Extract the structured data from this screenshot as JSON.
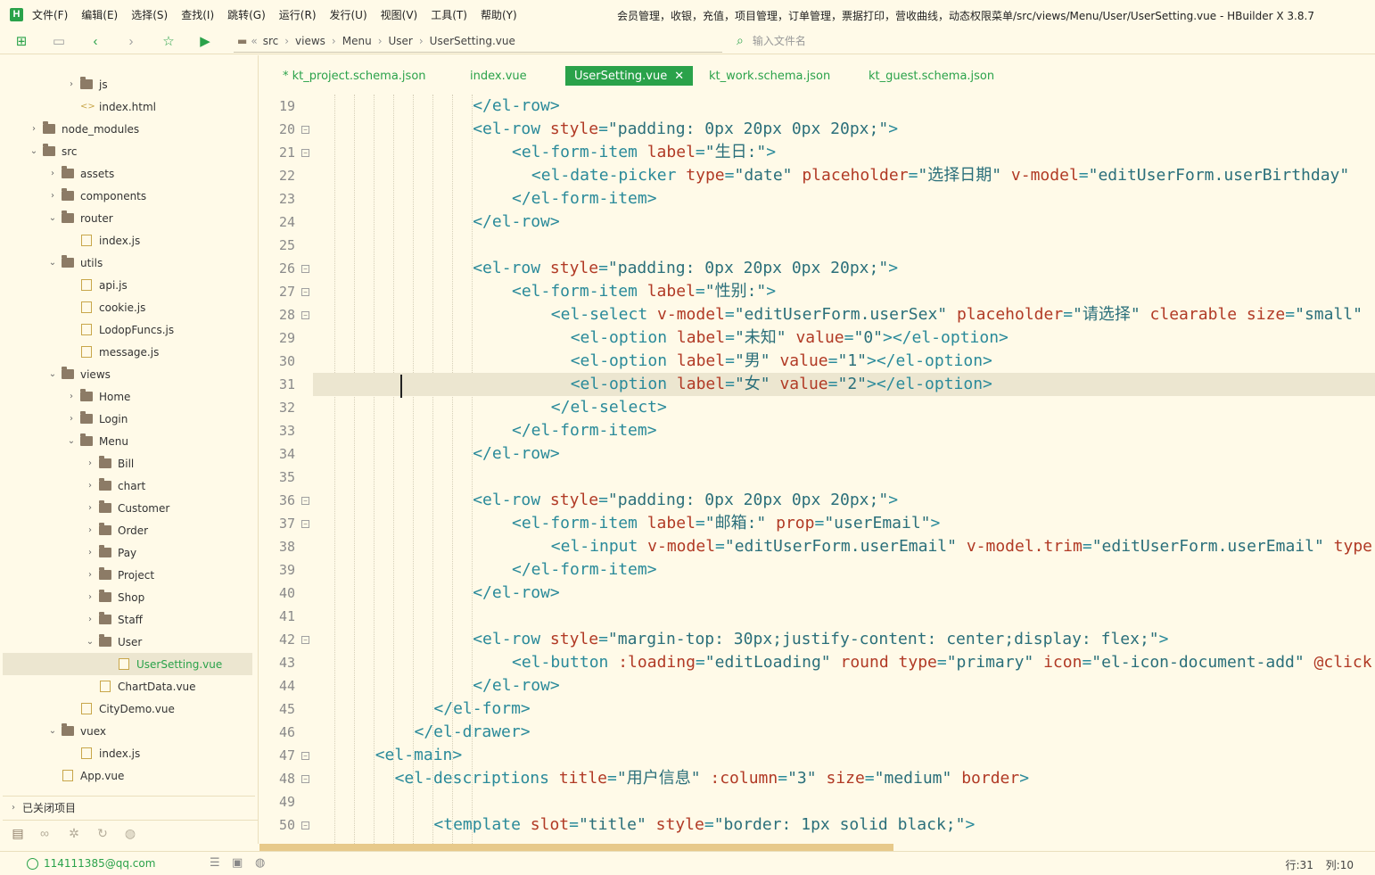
{
  "menubar": {
    "items": [
      "文件(F)",
      "编辑(E)",
      "选择(S)",
      "查找(I)",
      "跳转(G)",
      "运行(R)",
      "发行(U)",
      "视图(V)",
      "工具(T)",
      "帮助(Y)"
    ],
    "window_title": "会员管理，收银，充值，项目管理，订单管理，票据打印，营收曲线，动态权限菜单/src/views/Menu/User/UserSetting.vue - HBuilder X 3.8.7"
  },
  "toolbar": {
    "breadcrumb": [
      "src",
      "views",
      "Menu",
      "User",
      "UserSetting.vue"
    ],
    "file_search_placeholder": "输入文件名"
  },
  "sidebar": {
    "tree": [
      {
        "label": "js",
        "type": "folder",
        "depth": 3,
        "expanded": false
      },
      {
        "label": "index.html",
        "type": "html",
        "depth": 3
      },
      {
        "label": "node_modules",
        "type": "folder",
        "depth": 1,
        "expanded": false
      },
      {
        "label": "src",
        "type": "folder",
        "depth": 1,
        "expanded": true
      },
      {
        "label": "assets",
        "type": "folder",
        "depth": 2,
        "expanded": false
      },
      {
        "label": "components",
        "type": "folder",
        "depth": 2,
        "expanded": false
      },
      {
        "label": "router",
        "type": "folder",
        "depth": 2,
        "expanded": true
      },
      {
        "label": "index.js",
        "type": "file",
        "depth": 3
      },
      {
        "label": "utils",
        "type": "folder",
        "depth": 2,
        "expanded": true
      },
      {
        "label": "api.js",
        "type": "file",
        "depth": 3
      },
      {
        "label": "cookie.js",
        "type": "file",
        "depth": 3
      },
      {
        "label": "LodopFuncs.js",
        "type": "file",
        "depth": 3
      },
      {
        "label": "message.js",
        "type": "file",
        "depth": 3
      },
      {
        "label": "views",
        "type": "folder",
        "depth": 2,
        "expanded": true
      },
      {
        "label": "Home",
        "type": "folder",
        "depth": 3,
        "expanded": false
      },
      {
        "label": "Login",
        "type": "folder",
        "depth": 3,
        "expanded": false
      },
      {
        "label": "Menu",
        "type": "folder",
        "depth": 3,
        "expanded": true
      },
      {
        "label": "Bill",
        "type": "folder",
        "depth": 4,
        "expanded": false
      },
      {
        "label": "chart",
        "type": "folder",
        "depth": 4,
        "expanded": false
      },
      {
        "label": "Customer",
        "type": "folder",
        "depth": 4,
        "expanded": false
      },
      {
        "label": "Order",
        "type": "folder",
        "depth": 4,
        "expanded": false
      },
      {
        "label": "Pay",
        "type": "folder",
        "depth": 4,
        "expanded": false
      },
      {
        "label": "Project",
        "type": "folder",
        "depth": 4,
        "expanded": false
      },
      {
        "label": "Shop",
        "type": "folder",
        "depth": 4,
        "expanded": false
      },
      {
        "label": "Staff",
        "type": "folder",
        "depth": 4,
        "expanded": false
      },
      {
        "label": "User",
        "type": "folder",
        "depth": 4,
        "expanded": true
      },
      {
        "label": "UserSetting.vue",
        "type": "file",
        "depth": 5,
        "selected": true
      },
      {
        "label": "ChartData.vue",
        "type": "file",
        "depth": 4
      },
      {
        "label": "CityDemo.vue",
        "type": "file",
        "depth": 3
      },
      {
        "label": "vuex",
        "type": "folder",
        "depth": 2,
        "expanded": true
      },
      {
        "label": "index.js",
        "type": "file",
        "depth": 3
      },
      {
        "label": "App.vue",
        "type": "file",
        "depth": 2
      }
    ],
    "closed_projects": "已关闭项目"
  },
  "tabs": [
    {
      "label": "* kt_project.schema.json",
      "active": false
    },
    {
      "label": "index.vue",
      "active": false
    },
    {
      "label": "UserSetting.vue",
      "active": true
    },
    {
      "label": "kt_work.schema.json",
      "active": false
    },
    {
      "label": "kt_guest.schema.json",
      "active": false
    }
  ],
  "editor": {
    "current_line": 31,
    "lines": [
      {
        "n": "19",
        "indent": 8,
        "fold": false,
        "tokens": [
          [
            "tg",
            "</el-row>"
          ]
        ]
      },
      {
        "n": "20",
        "indent": 8,
        "fold": true,
        "tokens": [
          [
            "tg",
            "<el-row "
          ],
          [
            "at",
            "style"
          ],
          [
            "pc",
            "="
          ],
          [
            "st",
            "\"padding: 0px 20px 0px 20px;\""
          ],
          [
            "tg",
            ">"
          ]
        ]
      },
      {
        "n": "21",
        "indent": 10,
        "fold": true,
        "tokens": [
          [
            "tg",
            "<el-form-item "
          ],
          [
            "at",
            "label"
          ],
          [
            "pc",
            "="
          ],
          [
            "st",
            "\"生日:\""
          ],
          [
            "tg",
            ">"
          ]
        ]
      },
      {
        "n": "22",
        "indent": 11,
        "fold": false,
        "tokens": [
          [
            "tg",
            "<el-date-picker "
          ],
          [
            "at",
            "type"
          ],
          [
            "pc",
            "="
          ],
          [
            "st",
            "\"date\" "
          ],
          [
            "at",
            "placeholder"
          ],
          [
            "pc",
            "="
          ],
          [
            "st",
            "\"选择日期\" "
          ],
          [
            "at",
            "v-model"
          ],
          [
            "pc",
            "="
          ],
          [
            "st",
            "\"editUserForm.userBirthday\""
          ]
        ]
      },
      {
        "n": "23",
        "indent": 10,
        "fold": false,
        "tokens": [
          [
            "tg",
            "</el-form-item>"
          ]
        ]
      },
      {
        "n": "24",
        "indent": 8,
        "fold": false,
        "tokens": [
          [
            "tg",
            "</el-row>"
          ]
        ]
      },
      {
        "n": "25",
        "indent": 0,
        "fold": false,
        "tokens": []
      },
      {
        "n": "26",
        "indent": 8,
        "fold": true,
        "tokens": [
          [
            "tg",
            "<el-row "
          ],
          [
            "at",
            "style"
          ],
          [
            "pc",
            "="
          ],
          [
            "st",
            "\"padding: 0px 20px 0px 20px;\""
          ],
          [
            "tg",
            ">"
          ]
        ]
      },
      {
        "n": "27",
        "indent": 10,
        "fold": true,
        "tokens": [
          [
            "tg",
            "<el-form-item "
          ],
          [
            "at",
            "label"
          ],
          [
            "pc",
            "="
          ],
          [
            "st",
            "\"性别:\""
          ],
          [
            "tg",
            ">"
          ]
        ]
      },
      {
        "n": "28",
        "indent": 12,
        "fold": true,
        "tokens": [
          [
            "tg",
            "<el-select "
          ],
          [
            "at",
            "v-model"
          ],
          [
            "pc",
            "="
          ],
          [
            "st",
            "\"editUserForm.userSex\" "
          ],
          [
            "at",
            "placeholder"
          ],
          [
            "pc",
            "="
          ],
          [
            "st",
            "\"请选择\" "
          ],
          [
            "at",
            "clearable "
          ],
          [
            "at",
            "size"
          ],
          [
            "pc",
            "="
          ],
          [
            "st",
            "\"small\""
          ]
        ]
      },
      {
        "n": "29",
        "indent": 13,
        "fold": false,
        "tokens": [
          [
            "tg",
            "<el-option "
          ],
          [
            "at",
            "label"
          ],
          [
            "pc",
            "="
          ],
          [
            "st",
            "\"未知\" "
          ],
          [
            "at",
            "value"
          ],
          [
            "pc",
            "="
          ],
          [
            "st",
            "\"0\""
          ],
          [
            "tg",
            "></el-option>"
          ]
        ]
      },
      {
        "n": "30",
        "indent": 13,
        "fold": false,
        "tokens": [
          [
            "tg",
            "<el-option "
          ],
          [
            "at",
            "label"
          ],
          [
            "pc",
            "="
          ],
          [
            "st",
            "\"男\" "
          ],
          [
            "at",
            "value"
          ],
          [
            "pc",
            "="
          ],
          [
            "st",
            "\"1\""
          ],
          [
            "tg",
            "></el-option>"
          ]
        ]
      },
      {
        "n": "31",
        "indent": 13,
        "fold": false,
        "tokens": [
          [
            "tg",
            "<el-option "
          ],
          [
            "at",
            "label"
          ],
          [
            "pc",
            "="
          ],
          [
            "st",
            "\"女\" "
          ],
          [
            "at",
            "value"
          ],
          [
            "pc",
            "="
          ],
          [
            "st",
            "\"2\""
          ],
          [
            "tg",
            "></el-option>"
          ]
        ]
      },
      {
        "n": "32",
        "indent": 12,
        "fold": false,
        "tokens": [
          [
            "tg",
            "</el-select>"
          ]
        ]
      },
      {
        "n": "33",
        "indent": 10,
        "fold": false,
        "tokens": [
          [
            "tg",
            "</el-form-item>"
          ]
        ]
      },
      {
        "n": "34",
        "indent": 8,
        "fold": false,
        "tokens": [
          [
            "tg",
            "</el-row>"
          ]
        ]
      },
      {
        "n": "35",
        "indent": 0,
        "fold": false,
        "tokens": []
      },
      {
        "n": "36",
        "indent": 8,
        "fold": true,
        "tokens": [
          [
            "tg",
            "<el-row "
          ],
          [
            "at",
            "style"
          ],
          [
            "pc",
            "="
          ],
          [
            "st",
            "\"padding: 0px 20px 0px 20px;\""
          ],
          [
            "tg",
            ">"
          ]
        ]
      },
      {
        "n": "37",
        "indent": 10,
        "fold": true,
        "tokens": [
          [
            "tg",
            "<el-form-item "
          ],
          [
            "at",
            "label"
          ],
          [
            "pc",
            "="
          ],
          [
            "st",
            "\"邮箱:\" "
          ],
          [
            "at",
            "prop"
          ],
          [
            "pc",
            "="
          ],
          [
            "st",
            "\"userEmail\""
          ],
          [
            "tg",
            ">"
          ]
        ]
      },
      {
        "n": "38",
        "indent": 12,
        "fold": false,
        "tokens": [
          [
            "tg",
            "<el-input "
          ],
          [
            "at",
            "v-model"
          ],
          [
            "pc",
            "="
          ],
          [
            "st",
            "\"editUserForm.userEmail\" "
          ],
          [
            "at",
            "v-model.trim"
          ],
          [
            "pc",
            "="
          ],
          [
            "st",
            "\"editUserForm.userEmail\" "
          ],
          [
            "at",
            "type"
          ]
        ]
      },
      {
        "n": "39",
        "indent": 10,
        "fold": false,
        "tokens": [
          [
            "tg",
            "</el-form-item>"
          ]
        ]
      },
      {
        "n": "40",
        "indent": 8,
        "fold": false,
        "tokens": [
          [
            "tg",
            "</el-row>"
          ]
        ]
      },
      {
        "n": "41",
        "indent": 0,
        "fold": false,
        "tokens": []
      },
      {
        "n": "42",
        "indent": 8,
        "fold": true,
        "tokens": [
          [
            "tg",
            "<el-row "
          ],
          [
            "at",
            "style"
          ],
          [
            "pc",
            "="
          ],
          [
            "st",
            "\"margin-top: 30px;justify-content: center;display: flex;\""
          ],
          [
            "tg",
            ">"
          ]
        ]
      },
      {
        "n": "43",
        "indent": 10,
        "fold": false,
        "tokens": [
          [
            "tg",
            "<el-button "
          ],
          [
            "at",
            ":loading"
          ],
          [
            "pc",
            "="
          ],
          [
            "st",
            "\"editLoading\" "
          ],
          [
            "at",
            "round "
          ],
          [
            "at",
            "type"
          ],
          [
            "pc",
            "="
          ],
          [
            "st",
            "\"primary\" "
          ],
          [
            "at",
            "icon"
          ],
          [
            "pc",
            "="
          ],
          [
            "st",
            "\"el-icon-document-add\" "
          ],
          [
            "at",
            "@click"
          ]
        ]
      },
      {
        "n": "44",
        "indent": 8,
        "fold": false,
        "tokens": [
          [
            "tg",
            "</el-row>"
          ]
        ]
      },
      {
        "n": "45",
        "indent": 6,
        "fold": false,
        "tokens": [
          [
            "tg",
            "</el-form>"
          ]
        ]
      },
      {
        "n": "46",
        "indent": 5,
        "fold": false,
        "tokens": [
          [
            "tg",
            "</el-drawer>"
          ]
        ]
      },
      {
        "n": "47",
        "indent": 3,
        "fold": true,
        "tokens": [
          [
            "tg",
            "<el-main>"
          ]
        ]
      },
      {
        "n": "48",
        "indent": 4,
        "fold": true,
        "tokens": [
          [
            "tg",
            "<el-descriptions "
          ],
          [
            "at",
            "title"
          ],
          [
            "pc",
            "="
          ],
          [
            "st",
            "\"用户信息\" "
          ],
          [
            "at",
            ":column"
          ],
          [
            "pc",
            "="
          ],
          [
            "st",
            "\"3\" "
          ],
          [
            "at",
            "size"
          ],
          [
            "pc",
            "="
          ],
          [
            "st",
            "\"medium\" "
          ],
          [
            "at",
            "border"
          ],
          [
            "tg",
            ">"
          ]
        ]
      },
      {
        "n": "49",
        "indent": 0,
        "fold": false,
        "tokens": []
      },
      {
        "n": "50",
        "indent": 6,
        "fold": true,
        "tokens": [
          [
            "tg",
            "<template "
          ],
          [
            "at",
            "slot"
          ],
          [
            "pc",
            "="
          ],
          [
            "st",
            "\"title\" "
          ],
          [
            "at",
            "style"
          ],
          [
            "pc",
            "="
          ],
          [
            "st",
            "\"border: 1px solid black;\""
          ],
          [
            "tg",
            ">"
          ]
        ]
      }
    ]
  },
  "statusbar": {
    "account": "114111385@qq.com",
    "line_label": "行:31",
    "col_label": "列:10"
  },
  "colors": {
    "accent": "#2aa24a",
    "background": "#fffae8",
    "tag": "#2a8a9a",
    "attribute": "#b13a25",
    "string": "#2a6f7a"
  }
}
